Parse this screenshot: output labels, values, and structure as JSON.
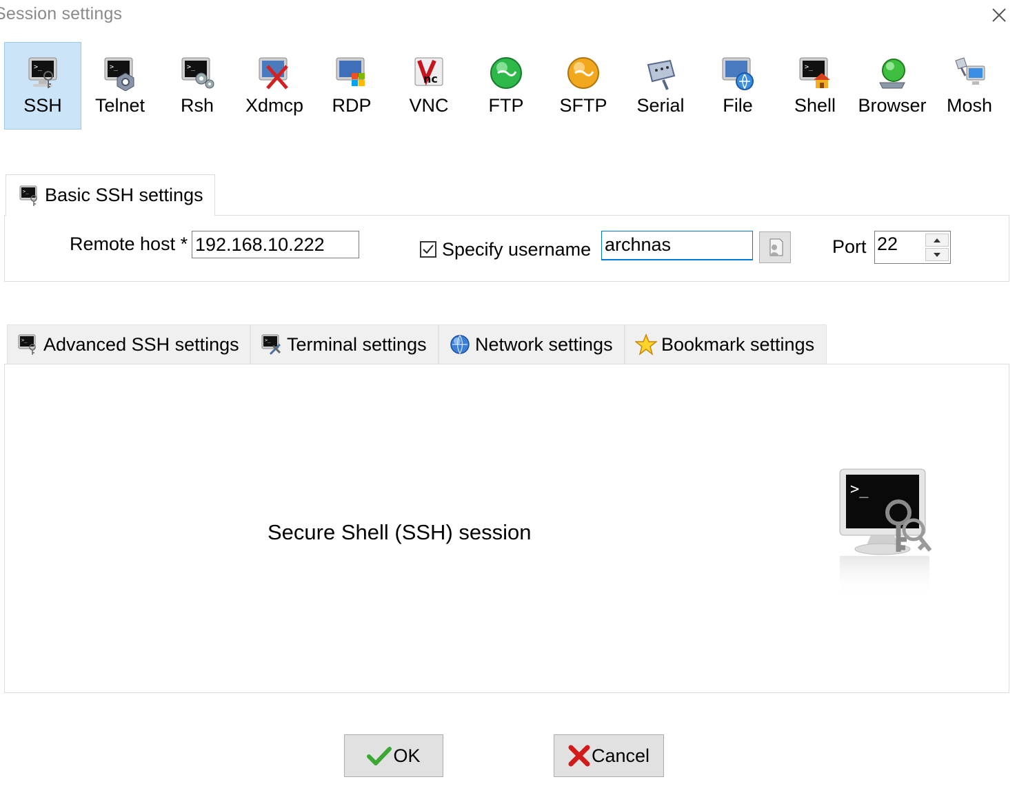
{
  "window": {
    "title": "Session settings",
    "close_icon": "close-icon"
  },
  "session_types": [
    {
      "label": "SSH",
      "icon": "ssh-icon",
      "active": true
    },
    {
      "label": "Telnet",
      "icon": "telnet-icon"
    },
    {
      "label": "Rsh",
      "icon": "rsh-icon"
    },
    {
      "label": "Xdmcp",
      "icon": "xdmcp-icon"
    },
    {
      "label": "RDP",
      "icon": "rdp-icon"
    },
    {
      "label": "VNC",
      "icon": "vnc-icon"
    },
    {
      "label": "FTP",
      "icon": "ftp-icon"
    },
    {
      "label": "SFTP",
      "icon": "sftp-icon"
    },
    {
      "label": "Serial",
      "icon": "serial-icon"
    },
    {
      "label": "File",
      "icon": "file-icon"
    },
    {
      "label": "Shell",
      "icon": "shell-icon"
    },
    {
      "label": "Browser",
      "icon": "browser-icon"
    },
    {
      "label": "Mosh",
      "icon": "mosh-icon"
    }
  ],
  "basic": {
    "tab_label": "Basic SSH settings",
    "remote_host_label": "Remote host *",
    "remote_host_value": "192.168.10.222",
    "specify_username_label": "Specify username",
    "specify_username_checked": true,
    "username_value": "archnas",
    "port_label": "Port",
    "port_value": "22"
  },
  "advanced_tabs": [
    {
      "label": "Advanced SSH settings",
      "icon": "ssh-settings-icon"
    },
    {
      "label": "Terminal settings",
      "icon": "terminal-settings-icon"
    },
    {
      "label": "Network settings",
      "icon": "globe-icon"
    },
    {
      "label": "Bookmark settings",
      "icon": "star-icon"
    }
  ],
  "description": "Secure Shell (SSH) session",
  "buttons": {
    "ok": "OK",
    "cancel": "Cancel"
  },
  "colors": {
    "active_bg": "#cce4f7",
    "focus_border": "#0078d7"
  }
}
